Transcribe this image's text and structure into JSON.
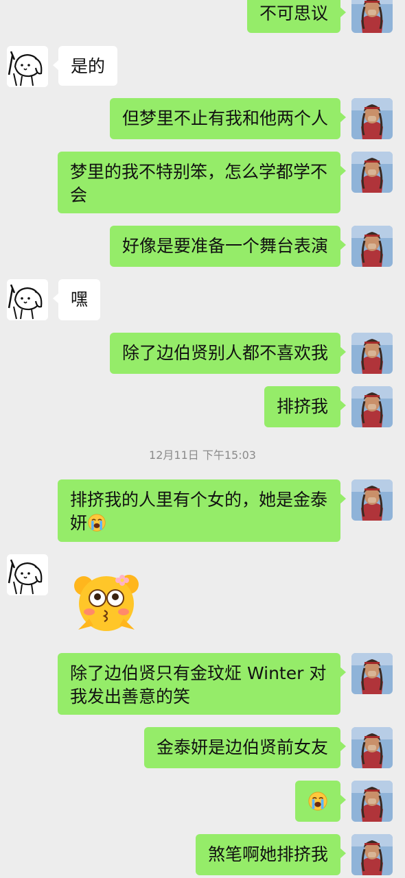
{
  "messages": [
    {
      "id": "m1",
      "text": "不可思议"
    },
    {
      "id": "m2",
      "text": "是的"
    },
    {
      "id": "m3",
      "text": "但梦里不止有我和他两个人"
    },
    {
      "id": "m4",
      "text": "梦里的我不特别笨，怎么学都学不会"
    },
    {
      "id": "m5",
      "text": "好像是要准备一个舞台表演"
    },
    {
      "id": "m6",
      "text": "嘿"
    },
    {
      "id": "m7",
      "text": "除了边伯贤别人都不喜欢我"
    },
    {
      "id": "m8",
      "text": "排挤我"
    },
    {
      "id": "m9",
      "text": "排挤我的人里有个女的，她是金泰妍"
    },
    {
      "id": "m10",
      "sticker": "blushing-emoji-sticker"
    },
    {
      "id": "m11",
      "text": "除了边伯贤只有金玟炡 Winter 对我发出善意的笑"
    },
    {
      "id": "m12",
      "text": "金泰妍是边伯贤前女友"
    },
    {
      "id": "m13",
      "emoji": "crying-emoji"
    },
    {
      "id": "m14",
      "text": "煞笔啊她排挤我"
    }
  ],
  "timestamp": "12月11日 下午15:03",
  "colors": {
    "background": "#ededed",
    "my_bubble": "#95ec69",
    "their_bubble": "#ffffff"
  }
}
